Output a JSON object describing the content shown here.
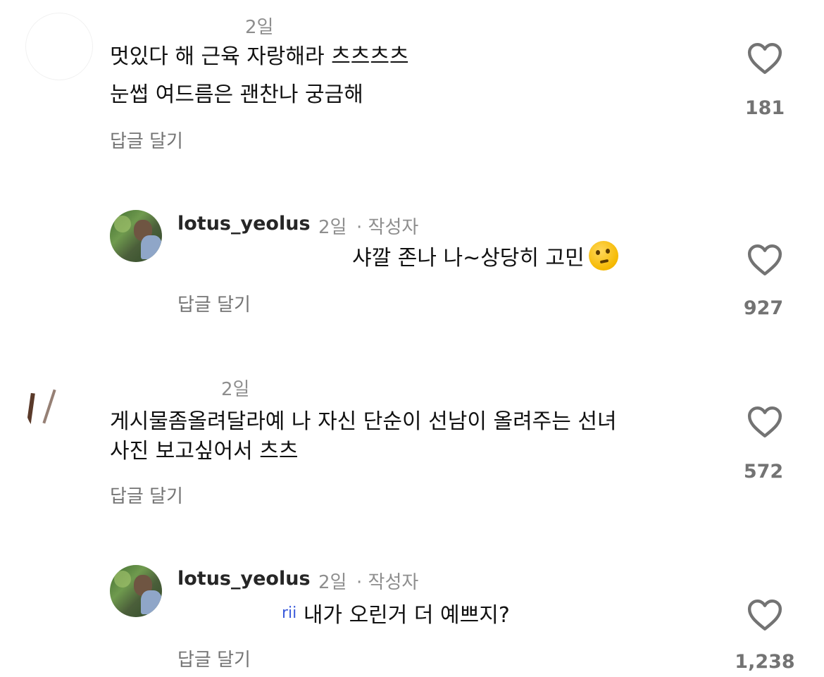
{
  "comments": [
    {
      "username": "",
      "time": "2일",
      "author_tag": "",
      "mention": "",
      "lines": [
        "멋있다 해 근육 자랑해라 츠츠츠츠",
        "눈썹 여드름은 괜찬나 궁금해"
      ],
      "reply_label": "답글 달기",
      "likes": "181"
    },
    {
      "username": "lotus_yeolus",
      "time": "2일",
      "author_tag": "· 작성자",
      "mention": "",
      "lines": [
        "샤깔 존나 나~상당히 고민"
      ],
      "reply_label": "답글 달기",
      "likes": "927"
    },
    {
      "username": "",
      "time": "2일",
      "author_tag": "",
      "mention": "",
      "lines": [
        "게시물좀올려달라예 나 자신 단순이 선남이 올려주는 선녀",
        "사진 보고싶어서 츠츠"
      ],
      "reply_label": "답글 달기",
      "likes": "572"
    },
    {
      "username": "lotus_yeolus",
      "time": "2일",
      "author_tag": "· 작성자",
      "mention": "rii",
      "lines": [
        "내가 오린거 더 예쁘지?"
      ],
      "reply_label": "답글 달기",
      "likes": "1,238"
    }
  ],
  "icons": {
    "like": "heart-outline-icon",
    "emoji": "thinking-face-emoji"
  }
}
